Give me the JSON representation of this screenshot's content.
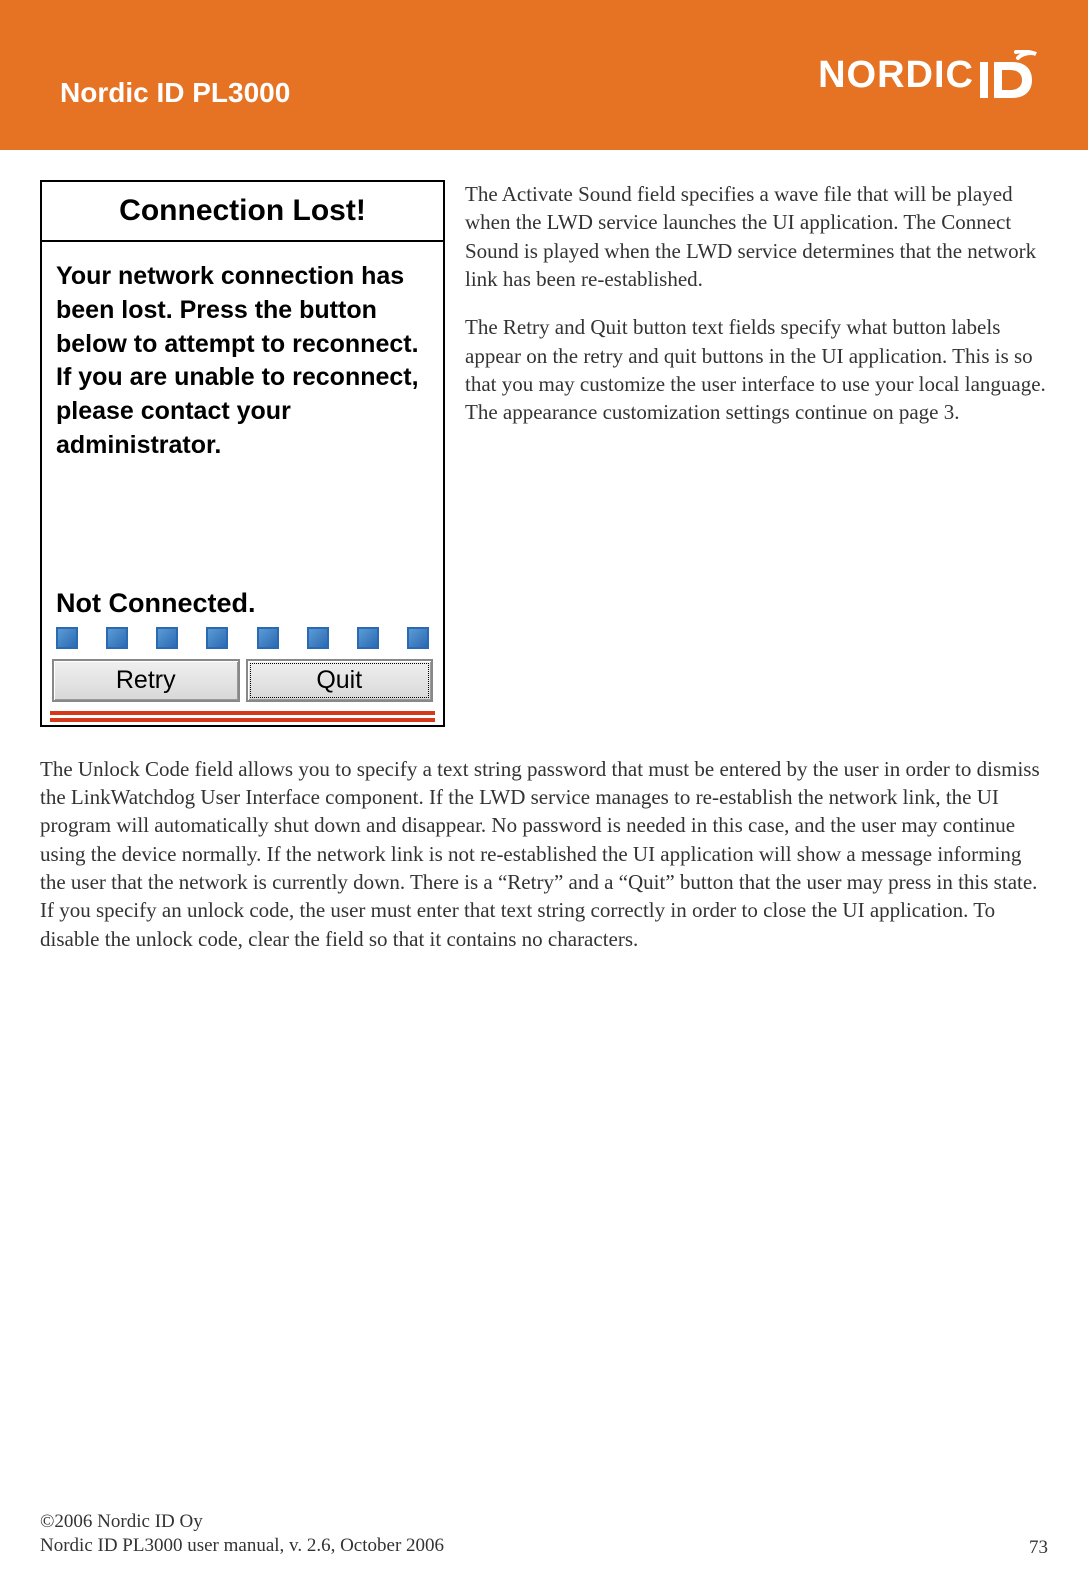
{
  "header": {
    "title": "Nordic ID PL3000",
    "logo_text": "NORDIC",
    "colors": {
      "banner_bg": "#e67323",
      "banner_fg": "#ffffff"
    }
  },
  "dialog": {
    "title": "Connection Lost!",
    "message": "Your network connection has been lost. Press the button below to attempt to reconnect. If you are unable to reconnect, please contact your administrator.",
    "status": "Not Connected.",
    "buttons": {
      "retry": "Retry",
      "quit": "Quit"
    },
    "progress_square_count": 8
  },
  "body": {
    "para1": "The Activate Sound field specifies a wave file that will be played when the LWD service launches the UI application. The Connect Sound is played when the LWD service determines that the network link has been re-established.",
    "para2": "The Retry and Quit button text fields specify what button labels appear on the retry and quit buttons in the UI application. This is so that you may customize the user interface to use your local language. The appearance customization settings continue on page 3.",
    "para3": "The Unlock Code field allows you to specify a text string password that must be entered by the user in order to dismiss the LinkWatchdog User Interface component. If the LWD service manages to re-establish the network link, the UI program will automatically shut down and disappear. No password is needed in this case, and the user may continue using the device normally. If the network link is not re-established the UI application will show a message informing the user that the network is currently down. There is a “Retry” and a “Quit” button that the user may press in this state. If you specify an unlock code, the user must enter that text string correctly in order to close the UI application. To disable the unlock code, clear the field so that it contains no characters."
  },
  "footer": {
    "copyright": "©2006 Nordic ID Oy",
    "manual_line": "Nordic ID PL3000 user manual, v. 2.6, October 2006",
    "page_number": "73"
  }
}
